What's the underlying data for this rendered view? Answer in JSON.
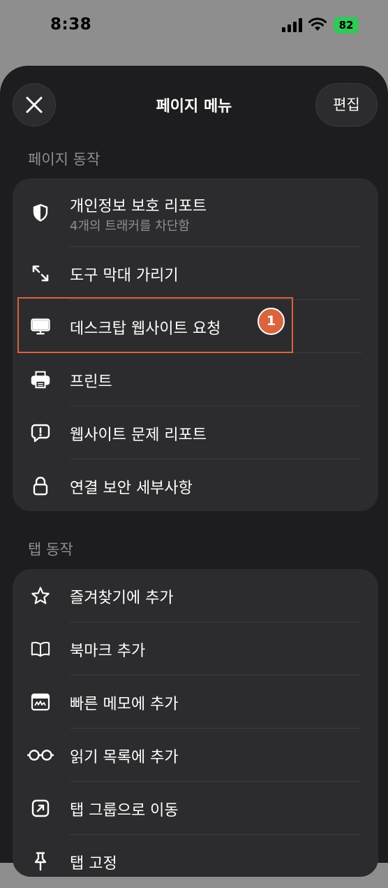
{
  "status_bar": {
    "time": "8:38",
    "battery": "82"
  },
  "header": {
    "title": "페이지 메뉴",
    "edit_label": "편집"
  },
  "page_actions": {
    "section_label": "페이지 동작",
    "items": [
      {
        "label": "개인정보 보호 리포트",
        "sublabel": "4개의 트래커를 차단함",
        "icon": "shield-icon"
      },
      {
        "label": "도구 막대 가리기",
        "icon": "expand-arrows-icon"
      },
      {
        "label": "데스크탑 웹사이트 요청",
        "icon": "desktop-icon"
      },
      {
        "label": "프린트",
        "icon": "printer-icon"
      },
      {
        "label": "웹사이트 문제 리포트",
        "icon": "report-bubble-icon"
      },
      {
        "label": "연결 보안 세부사항",
        "icon": "lock-icon"
      }
    ]
  },
  "tab_actions": {
    "section_label": "탭 동작",
    "items": [
      {
        "label": "즐겨찾기에 추가",
        "icon": "star-icon"
      },
      {
        "label": "북마크 추가",
        "icon": "book-icon"
      },
      {
        "label": "빠른 메모에 추가",
        "icon": "quick-note-icon"
      },
      {
        "label": "읽기 목록에 추가",
        "icon": "glasses-icon"
      },
      {
        "label": "탭 그룹으로 이동",
        "icon": "move-to-group-icon"
      },
      {
        "label": "탭 고정",
        "icon": "pin-icon"
      }
    ]
  },
  "annotation": {
    "badge": "1",
    "accent": "#d9643e"
  },
  "colors": {
    "sheet": "#1d1d1f",
    "group": "#2c2c2e",
    "backdrop": "#8e8e8e",
    "battery": "#34c759"
  }
}
